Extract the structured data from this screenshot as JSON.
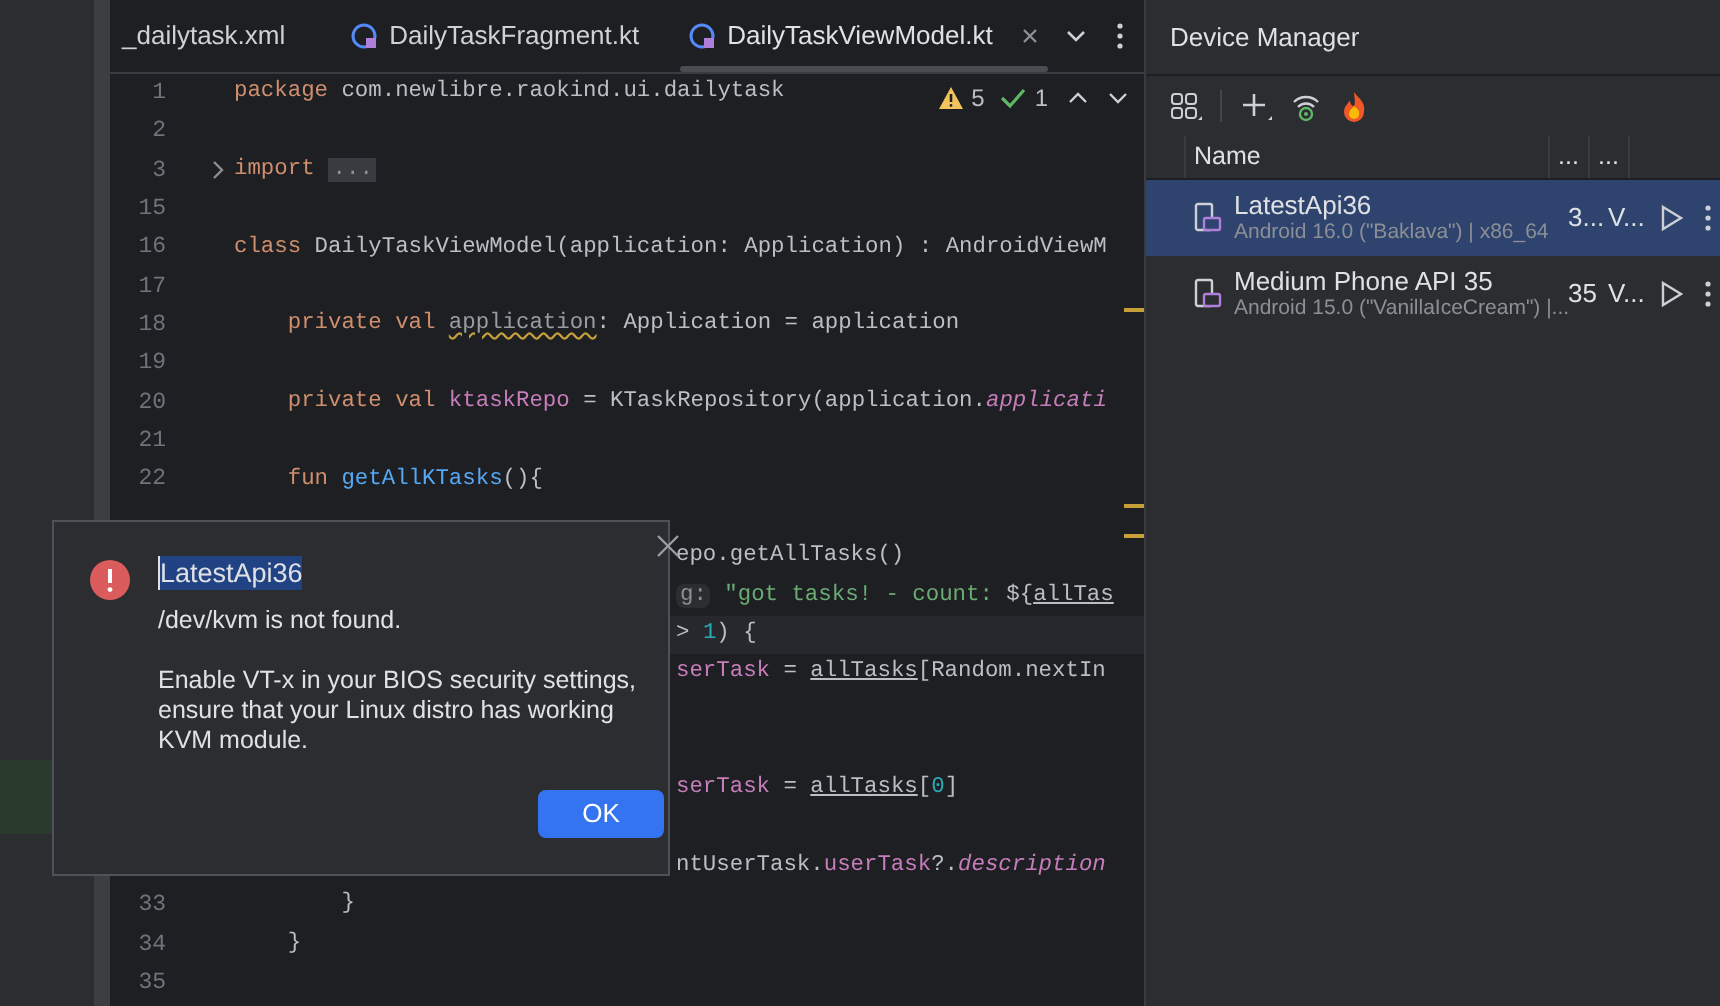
{
  "editor_tabs": [
    {
      "label": "_dailytask.xml",
      "kind": "xml",
      "selected": false
    },
    {
      "label": "DailyTaskFragment.kt",
      "kind": "kotlin",
      "selected": false
    },
    {
      "label": "DailyTaskViewModel.kt",
      "kind": "kotlin",
      "selected": true
    }
  ],
  "inspections": {
    "warnings": "5",
    "checks": "1"
  },
  "code_lines": [
    {
      "kind": "full",
      "number": "1",
      "tokens": [
        {
          "kind": "keyword",
          "text": "package"
        },
        {
          "kind": "plain",
          "text": " com.newlibre.raokind.ui.dailytask"
        }
      ]
    },
    {
      "kind": "full",
      "number": "2"
    },
    {
      "kind": "full",
      "number": "3",
      "tokens": [
        {
          "kind": "keyword",
          "text": "import"
        },
        {
          "kind": "fold",
          "text": "..."
        }
      ]
    },
    {
      "kind": "full",
      "number": "15"
    },
    {
      "kind": "full",
      "number": "16",
      "tokens": [
        {
          "kind": "keyword",
          "text": "class"
        },
        {
          "kind": "plain",
          "text": " DailyTaskViewModel(application: Application) : AndroidViewM"
        }
      ]
    },
    {
      "kind": "full",
      "number": "17"
    },
    {
      "kind": "full",
      "number": "18",
      "tokens": [
        {
          "kind": "keyword",
          "text": "    private val "
        },
        {
          "kind": "warned",
          "text": "application"
        },
        {
          "kind": "plain",
          "text": ": Application = application"
        }
      ]
    },
    {
      "kind": "full",
      "number": "19"
    },
    {
      "kind": "full",
      "number": "20",
      "tokens": [
        {
          "kind": "keyword",
          "text": "    private val "
        },
        {
          "kind": "property",
          "text": "ktaskRepo"
        },
        {
          "kind": "plain",
          "text": " = KTaskRepository(application."
        },
        {
          "kind": "italic",
          "text": "applicati"
        }
      ]
    },
    {
      "kind": "full",
      "number": "21"
    },
    {
      "kind": "full",
      "number": "22",
      "tokens": [
        {
          "kind": "keyword",
          "text": "    fun "
        },
        {
          "kind": "function",
          "text": "getAllKTasks"
        },
        {
          "kind": "plain",
          "text": "(){"
        }
      ]
    },
    {
      "kind": "covered"
    },
    {
      "kind": "covered",
      "tokens": [
        {
          "kind": "plain",
          "text": "epo.getAllTasks()"
        }
      ]
    },
    {
      "kind": "covered",
      "tokens": [
        {
          "kind": "hint",
          "text": "g:"
        },
        {
          "kind": "string",
          "text": " \"got tasks! - count: "
        },
        {
          "kind": "plain",
          "text": "${"
        },
        {
          "kind": "underlined",
          "text": "allTas"
        }
      ]
    },
    {
      "kind": "covered",
      "tokens": [
        {
          "kind": "plain",
          "text": "> "
        },
        {
          "kind": "number",
          "text": "1"
        },
        {
          "kind": "plain",
          "text": ") {"
        }
      ]
    },
    {
      "kind": "covered",
      "tokens": [
        {
          "kind": "property",
          "text": "serTask"
        },
        {
          "kind": "plain",
          "text": " = "
        },
        {
          "kind": "underlined",
          "text": "allTasks"
        },
        {
          "kind": "plain",
          "text": "[Random.nextIn"
        }
      ]
    },
    {
      "kind": "covered"
    },
    {
      "kind": "covered"
    },
    {
      "kind": "covered",
      "tokens": [
        {
          "kind": "property",
          "text": "serTask"
        },
        {
          "kind": "plain",
          "text": " = "
        },
        {
          "kind": "underlined",
          "text": "allTasks"
        },
        {
          "kind": "plain",
          "text": "["
        },
        {
          "kind": "number",
          "text": "0"
        },
        {
          "kind": "plain",
          "text": "]"
        }
      ]
    },
    {
      "kind": "covered"
    },
    {
      "kind": "covered",
      "tokens": [
        {
          "kind": "plain",
          "text": "ntUserTask."
        },
        {
          "kind": "property",
          "text": "userTask"
        },
        {
          "kind": "plain",
          "text": "?."
        },
        {
          "kind": "italic",
          "text": "description"
        }
      ]
    },
    {
      "kind": "full",
      "number": "33",
      "tokens": [
        {
          "kind": "plain",
          "text": "        }"
        }
      ]
    },
    {
      "kind": "full",
      "number": "34",
      "tokens": [
        {
          "kind": "plain",
          "text": "    }"
        }
      ]
    },
    {
      "kind": "full",
      "number": "35"
    }
  ],
  "dialog": {
    "title": "LatestApi36",
    "title_selected": true,
    "message": "/dev/kvm is not found.",
    "details": "Enable VT-x in your BIOS security settings, ensure that your Linux distro has working KVM module.",
    "button": "OK"
  },
  "device_manager": {
    "title": "Device Manager",
    "columns": [
      "Name",
      "...",
      "..."
    ],
    "devices": [
      {
        "name": "LatestApi36",
        "details": "Android 16.0 (\"Baklava\") | x86_64",
        "column_2": "3...",
        "column_3": "V...",
        "selected": true
      },
      {
        "name": "Medium Phone API 35",
        "details": "Android 15.0 (\"VanillaIceCream\") |...",
        "column_2": "35",
        "column_3": "V...",
        "selected": false
      }
    ]
  }
}
